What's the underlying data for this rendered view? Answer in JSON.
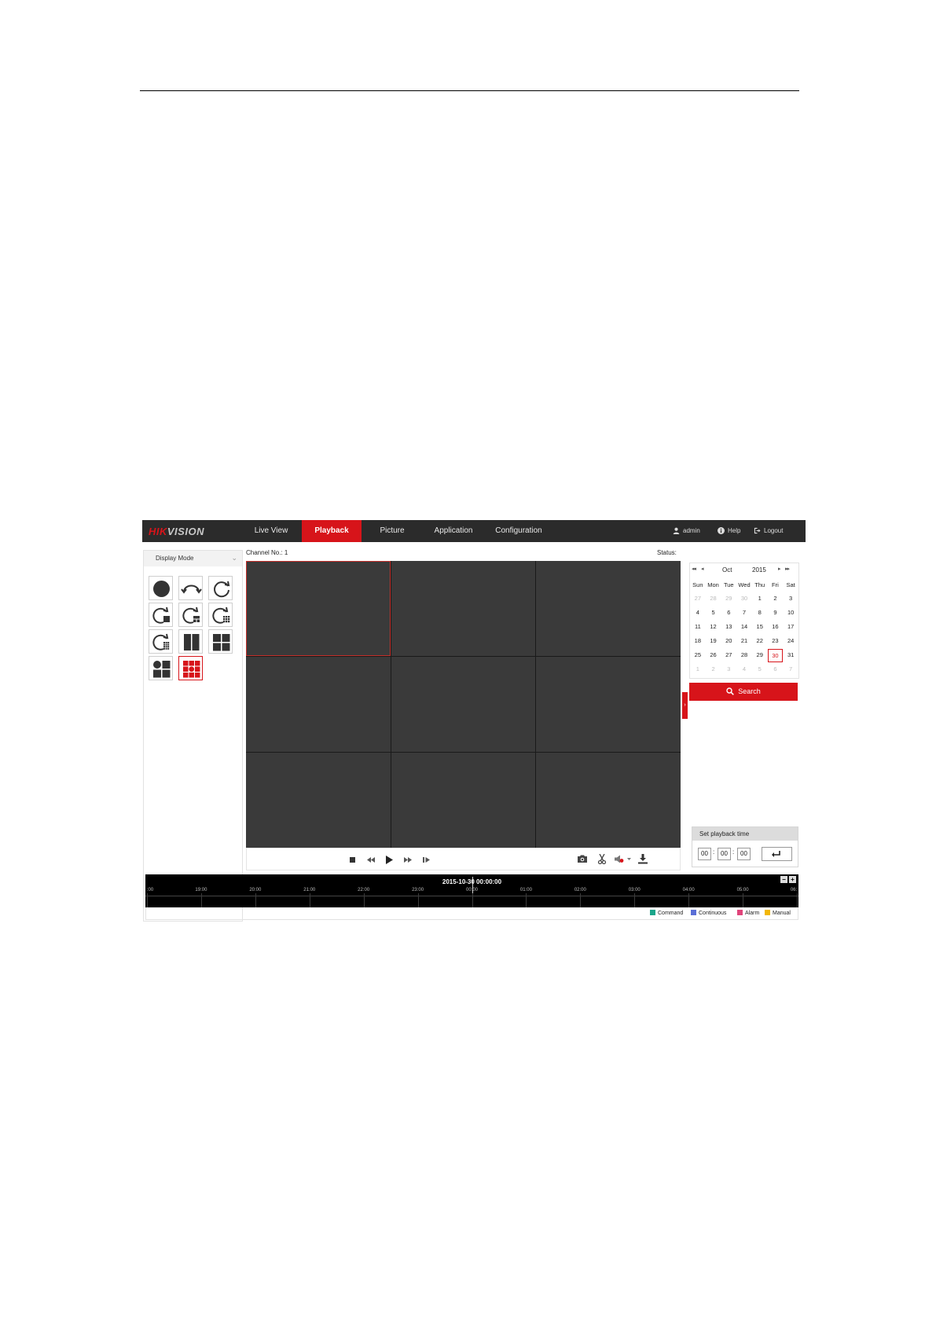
{
  "header": {
    "logo_part1": "HIK",
    "logo_part2": "VISION"
  },
  "nav": {
    "live_view": "Live View",
    "playback": "Playback",
    "picture": "Picture",
    "application": "Application",
    "configuration": "Configuration",
    "active": "Playback"
  },
  "user": {
    "name": "admin",
    "help": "Help",
    "logout": "Logout"
  },
  "left_panel": {
    "title": "Display Mode",
    "collapse_glyph": "⌄",
    "modes": [
      "fisheye",
      "180-panorama",
      "360-panorama",
      "360-panorama-plus-ptz",
      "360-panorama-plus-3ptz",
      "360-panorama-plus-6ptz",
      "360-panorama-plus-8ptz",
      "2-ptz",
      "4-ptz",
      "fisheye-plus-3ptz",
      "fisheye-plus-8ptz"
    ],
    "selected_mode": "fisheye-plus-8ptz"
  },
  "main": {
    "channel_label": "Channel No.: 1",
    "status_label": "Status:",
    "side_tab_glyph": "›",
    "grid_cells": 9,
    "selected_cell": 0
  },
  "calendar": {
    "month": "Oct",
    "year": "2015",
    "prev_year": "◂◂",
    "prev_month": "◂",
    "next_month": "▸",
    "next_year": "▸▸",
    "weekdays": [
      "Sun",
      "Mon",
      "Tue",
      "Wed",
      "Thu",
      "Fri",
      "Sat"
    ],
    "days": [
      {
        "d": "27",
        "muted": true
      },
      {
        "d": "28",
        "muted": true
      },
      {
        "d": "29",
        "muted": true
      },
      {
        "d": "30",
        "muted": true
      },
      {
        "d": "1"
      },
      {
        "d": "2"
      },
      {
        "d": "3"
      },
      {
        "d": "4"
      },
      {
        "d": "5"
      },
      {
        "d": "6"
      },
      {
        "d": "7"
      },
      {
        "d": "8"
      },
      {
        "d": "9"
      },
      {
        "d": "10"
      },
      {
        "d": "11"
      },
      {
        "d": "12"
      },
      {
        "d": "13"
      },
      {
        "d": "14"
      },
      {
        "d": "15"
      },
      {
        "d": "16"
      },
      {
        "d": "17"
      },
      {
        "d": "18"
      },
      {
        "d": "19"
      },
      {
        "d": "20"
      },
      {
        "d": "21"
      },
      {
        "d": "22"
      },
      {
        "d": "23"
      },
      {
        "d": "24"
      },
      {
        "d": "25"
      },
      {
        "d": "26"
      },
      {
        "d": "27"
      },
      {
        "d": "28"
      },
      {
        "d": "29"
      },
      {
        "d": "30",
        "today": true
      },
      {
        "d": "31"
      },
      {
        "d": "1",
        "muted": true
      },
      {
        "d": "2",
        "muted": true
      },
      {
        "d": "3",
        "muted": true
      },
      {
        "d": "4",
        "muted": true
      },
      {
        "d": "5",
        "muted": true
      },
      {
        "d": "6",
        "muted": true
      },
      {
        "d": "7",
        "muted": true
      }
    ]
  },
  "search": {
    "label": "Search"
  },
  "playback_time": {
    "title": "Set playback time",
    "hour": "00",
    "minute": "00",
    "second": "00",
    "separator": ":"
  },
  "timeline": {
    "current": "2015-10-30 00:00:00",
    "labels": [
      ":00",
      "19:00",
      "20:00",
      "21:00",
      "22:00",
      "23:00",
      "00:00",
      "01:00",
      "02:00",
      "03:00",
      "04:00",
      "05:00",
      "06:"
    ],
    "zoom_out": "−",
    "zoom_in": "+"
  },
  "legend": [
    {
      "label": "Command",
      "color": "#1aa58a"
    },
    {
      "label": "Continuous",
      "color": "#5b6fd6"
    },
    {
      "label": "Alarm",
      "color": "#e0457b"
    },
    {
      "label": "Manual",
      "color": "#f2b705"
    }
  ],
  "colors": {
    "accent": "#d7141a",
    "topbar": "#2b2b2b",
    "video_cell": "#3a3a3a"
  }
}
